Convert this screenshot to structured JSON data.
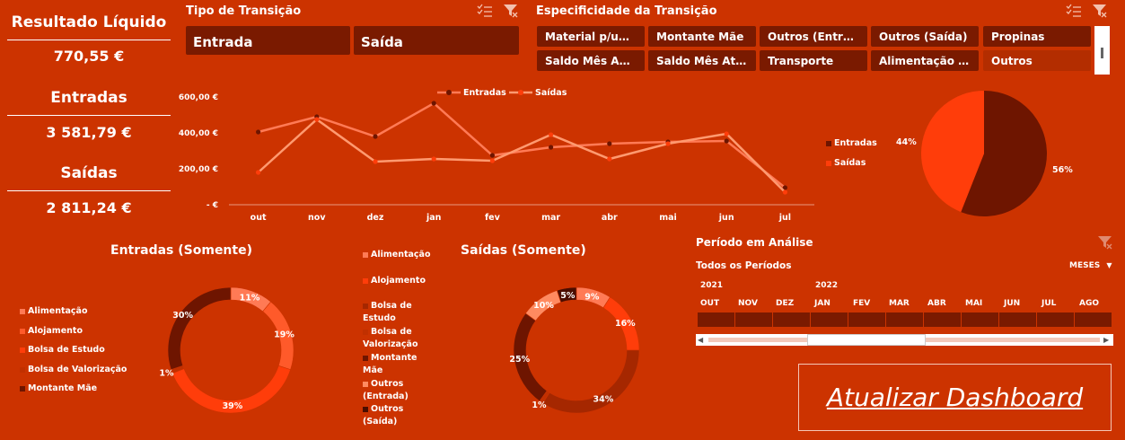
{
  "kpis": {
    "resultado_label": "Resultado Líquido",
    "resultado_value": "770,55 €",
    "entradas_label": "Entradas",
    "entradas_value": "3 581,79 €",
    "saidas_label": "Saídas",
    "saidas_value": "2 811,24 €"
  },
  "tipo_slicer": {
    "title": "Tipo de Transição",
    "items": [
      "Entrada",
      "Saída"
    ]
  },
  "espec_slicer": {
    "title": "Especificidade da Transição",
    "items": [
      "Material p/unive...",
      "Montante Mãe",
      "Outros (Entrada)",
      "Outros (Saída)",
      "Propinas",
      "Saldo Mês Anteri...",
      "Saldo Mês Atual",
      "Transporte",
      "Alimentação (Ind...",
      "Outros"
    ]
  },
  "line_chart": {
    "y_ticks": [
      "600,00 €",
      "400,00 €",
      "200,00 €",
      "-   €"
    ],
    "legend": [
      "Entradas",
      "Saídas"
    ]
  },
  "pie": {
    "legend": [
      "Entradas",
      "Saídas"
    ],
    "labels": [
      "44%",
      "56%"
    ]
  },
  "entradas_donut": {
    "title": "Entradas (Somente)",
    "legend": [
      "Alimentação",
      "Alojamento",
      "Bolsa de Estudo",
      "Bolsa de Valorização",
      "Montante Mãe"
    ],
    "labels": [
      "11%",
      "19%",
      "39%",
      "1%",
      "30%"
    ]
  },
  "saidas_donut": {
    "title": "Saídas (Somente)",
    "legend_left": [
      "Alimentação",
      "Alojamento",
      "Bolsa de Estudo",
      "Bolsa de Valorização",
      "Montante Mãe",
      "Outros (Entrada)",
      "Outros (Saída)"
    ],
    "labels": [
      "9%",
      "16%",
      "34%",
      "1%",
      "25%",
      "10%",
      "5%"
    ]
  },
  "timeline": {
    "title": "Período em Análise",
    "subtitle": "Todos os Períodos",
    "level": "MESES",
    "year1": "2021",
    "year2": "2022",
    "months": [
      "OUT",
      "NOV",
      "DEZ",
      "JAN",
      "FEV",
      "MAR",
      "ABR",
      "MAI",
      "JUN",
      "JUL",
      "AGO"
    ]
  },
  "refresh_button": "Atualizar Dashboard",
  "colors": {
    "background": "#cc3300",
    "dark": "#7a1a00",
    "entradas_line": "#ff7a55",
    "saidas_line": "#ff9a70",
    "pie_entradas": "#6e1500",
    "pie_saidas": "#ff3d0a"
  },
  "chart_data": [
    {
      "type": "line",
      "categories": [
        "out",
        "nov",
        "dez",
        "jan",
        "fev",
        "mar",
        "abr",
        "mai",
        "jun",
        "jul"
      ],
      "series": [
        {
          "name": "Entradas",
          "values": [
            405,
            490,
            380,
            565,
            275,
            320,
            340,
            350,
            355,
            95
          ]
        },
        {
          "name": "Saídas",
          "values": [
            180,
            475,
            240,
            255,
            245,
            390,
            255,
            340,
            395,
            70
          ]
        }
      ],
      "ylim": [
        0,
        600
      ]
    },
    {
      "type": "pie",
      "categories": [
        "Entradas",
        "Saídas"
      ],
      "values": [
        56,
        44
      ]
    },
    {
      "type": "pie",
      "title": "Entradas (Somente)",
      "categories": [
        "Alimentação",
        "Alojamento",
        "Bolsa de Estudo",
        "Bolsa de Valorização",
        "Montante Mãe"
      ],
      "values": [
        11,
        19,
        39,
        1,
        30
      ]
    },
    {
      "type": "pie",
      "title": "Saídas (Somente)",
      "values": [
        9,
        16,
        34,
        1,
        25,
        10,
        5
      ]
    }
  ]
}
